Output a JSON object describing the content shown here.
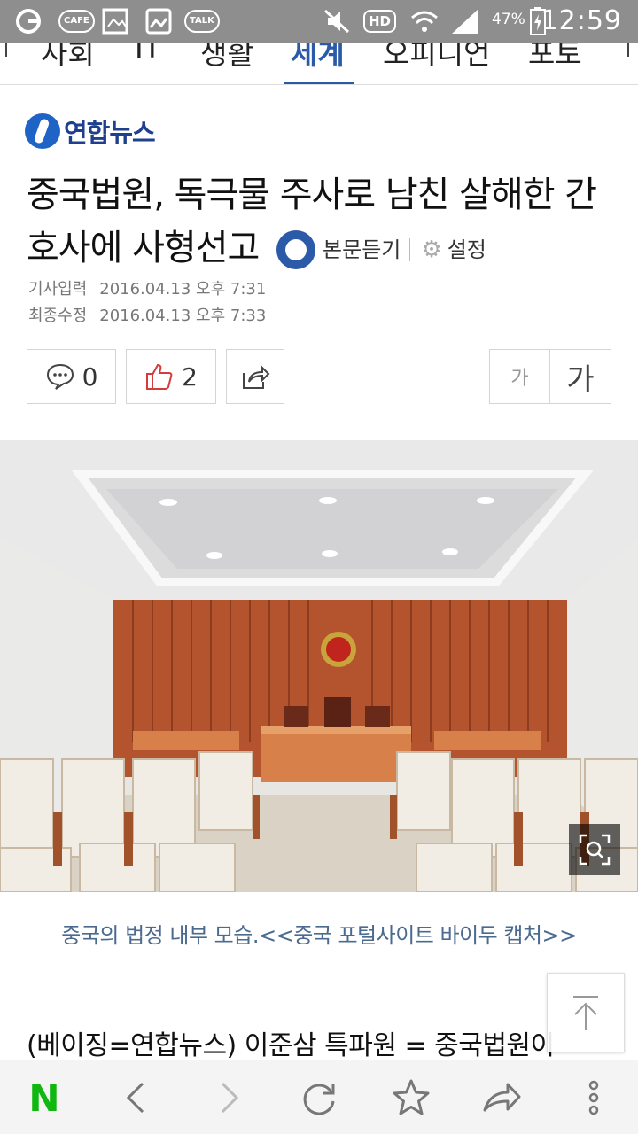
{
  "status_bar": {
    "battery": "47%",
    "time": "12:59",
    "icons": [
      "carrier-icon",
      "cafe-icon",
      "gallery-icon",
      "image-icon",
      "talk-icon",
      "mute-icon",
      "hd-icon",
      "wifi-icon",
      "signal-icon",
      "battery-icon"
    ],
    "cafe_label": "CAFE",
    "talk_label": "TALK",
    "hd_label": "HD"
  },
  "nav": {
    "tabs": [
      {
        "label": "사회"
      },
      {
        "label": "IT"
      },
      {
        "label": "생활"
      },
      {
        "label": "세계",
        "active": true
      },
      {
        "label": "오피니언"
      },
      {
        "label": "포토"
      }
    ],
    "accent_color": "#2a5aa8"
  },
  "brand": {
    "name": "연합뉴스"
  },
  "article": {
    "title": "중국법원, 독극물 주사로 남친 살해한 간호사에 사형선고",
    "listen_label": "본문듣기",
    "settings_label": "설정",
    "input_label": "기사입력",
    "input_date": "2016.04.13 오후 7:31",
    "modified_label": "최종수정",
    "modified_date": "2016.04.13 오후 7:33",
    "comment_count": "0",
    "like_count": "2",
    "font_small": "가",
    "font_large": "가",
    "caption": "중국의 법정 내부 모습.<<중국 포털사이트 바이두 캡처>>",
    "body_first_line": "(베이징=연합뉴스) 이준삼 특파원 = 중국법원이"
  },
  "bottom_bar": {
    "icons": [
      "naver-icon",
      "back-icon",
      "forward-icon",
      "refresh-icon",
      "bookmark-star-icon",
      "share-icon",
      "more-menu-icon"
    ],
    "naver_label": "N",
    "naver_color": "#11b711"
  }
}
